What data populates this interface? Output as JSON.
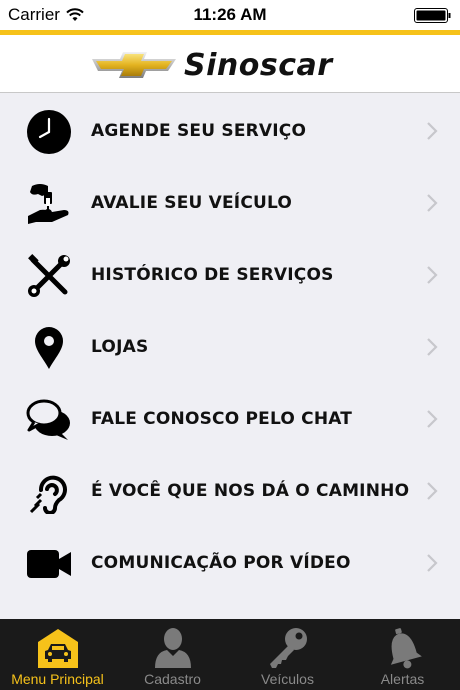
{
  "status_bar": {
    "carrier": "Carrier",
    "time": "11:26 AM",
    "icons": [
      "wifi-icon",
      "battery-icon"
    ]
  },
  "header": {
    "brand": "Sinoscar",
    "logo_icon": "chevrolet-bowtie-logo"
  },
  "menu": {
    "items": [
      {
        "label": "AGENDE SEU SERVIÇO",
        "icon": "clock-icon"
      },
      {
        "label": "AVALIE SEU VEÍCULO",
        "icon": "hand-money-icon"
      },
      {
        "label": "HISTÓRICO DE SERVIÇOS",
        "icon": "tools-icon"
      },
      {
        "label": "LOJAS",
        "icon": "map-pin-icon"
      },
      {
        "label": "FALE CONOSCO PELO CHAT",
        "icon": "chat-bubbles-icon"
      },
      {
        "label": "É VOCÊ QUE NOS DÁ O CAMINHO",
        "icon": "hearing-icon"
      },
      {
        "label": "COMUNICAÇÃO POR VÍDEO",
        "icon": "video-camera-icon"
      }
    ]
  },
  "tab_bar": {
    "tabs": [
      {
        "label": "Menu Principal",
        "icon": "car-home-icon",
        "active": true
      },
      {
        "label": "Cadastro",
        "icon": "person-icon",
        "active": false
      },
      {
        "label": "Veículos",
        "icon": "key-icon",
        "active": false
      },
      {
        "label": "Alertas",
        "icon": "bell-icon",
        "active": false
      }
    ]
  },
  "colors": {
    "accent": "#f6c21a",
    "menu_background": "#efeff4",
    "tab_bar_background": "#1a1a1a",
    "tab_inactive": "#8a8a8a"
  }
}
